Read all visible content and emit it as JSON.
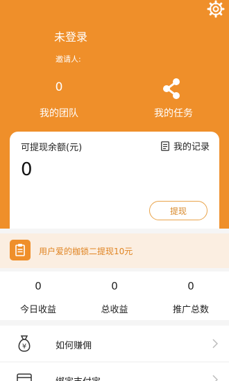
{
  "colors": {
    "accent": "#ef8f2a",
    "notice_bg": "#fbeee1",
    "notice_text": "#e08422"
  },
  "profile": {
    "username": "未登录",
    "inviter_label": "邀请人:"
  },
  "team": {
    "count": "0",
    "label": "我的团队"
  },
  "task": {
    "label": "我的任务",
    "icon": "share-icon"
  },
  "settings": {
    "icon": "gear-icon"
  },
  "balance": {
    "title": "可提现余额(元)",
    "records_label": "我的记录",
    "value": "0",
    "withdraw_label": "提现"
  },
  "notice": {
    "text": "用户爱的枷锁二提现10元",
    "icon": "clipboard-icon"
  },
  "stats": [
    {
      "value": "0",
      "label": "今日收益"
    },
    {
      "value": "0",
      "label": "总收益"
    },
    {
      "value": "0",
      "label": "推广总数"
    }
  ],
  "menu": [
    {
      "label": "如何赚佣",
      "icon": "money-bag-icon"
    },
    {
      "label": "绑定支付宝",
      "icon": "wallet-icon"
    }
  ]
}
